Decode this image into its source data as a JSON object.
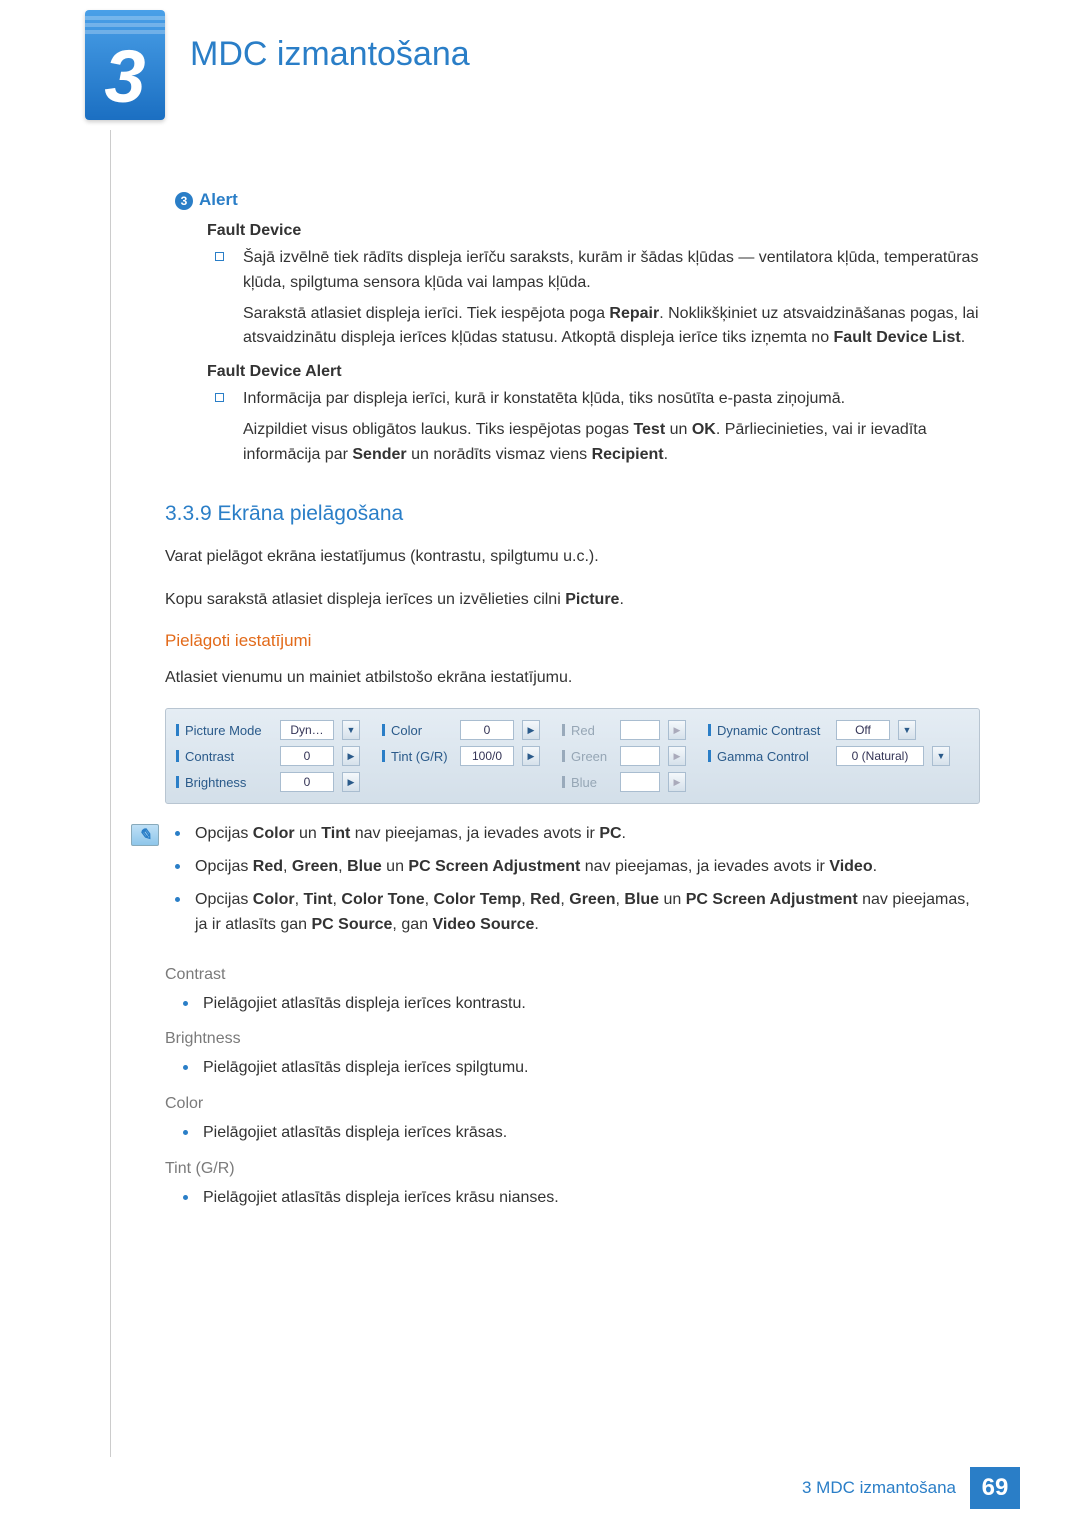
{
  "chapter": {
    "number": "3",
    "title": "MDC izmantošana"
  },
  "alert": {
    "badge": "3",
    "title": "Alert",
    "fault_device_h": "Fault Device",
    "fault_device_p1": "Šajā izvēlnē tiek rādīts displeja ierīču saraksts, kurām ir šādas kļūdas — ventilatora kļūda, temperatūras kļūda, spilgtuma sensora kļūda vai lampas kļūda.",
    "fault_device_p2a": "Sarakstā atlasiet displeja ierīci. Tiek iespējota poga ",
    "fault_device_p2_bold1": "Repair",
    "fault_device_p2b": ". Noklikšķiniet uz atsvaidzināšanas pogas, lai atsvaidzinātu displeja ierīces kļūdas statusu. Atkoptā displeja ierīce tiks izņemta no ",
    "fault_device_p2_bold2": "Fault Device List",
    "fault_device_p2c": ".",
    "fault_alert_h": "Fault Device Alert",
    "fault_alert_p1": "Informācija par displeja ierīci, kurā ir konstatēta kļūda, tiks nosūtīta e-pasta ziņojumā.",
    "fault_alert_p2a": "Aizpildiet visus obligātos laukus. Tiks iespējotas pogas ",
    "fault_alert_p2_b1": "Test",
    "fault_alert_p2_mid": " un ",
    "fault_alert_p2_b2": "OK",
    "fault_alert_p2b": ". Pārliecinieties, vai ir ievadīta informācija par ",
    "fault_alert_p2_b3": "Sender",
    "fault_alert_p2c": " un norādīts vismaz viens ",
    "fault_alert_p2_b4": "Recipient",
    "fault_alert_p2d": "."
  },
  "section": {
    "num_title": "3.3.9  Ekrāna pielāgošana",
    "intro1": "Varat pielāgot ekrāna iestatījumus (kontrastu, spilgtumu u.c.).",
    "intro2a": "Kopu sarakstā atlasiet displeja ierīces un izvēlieties cilni ",
    "intro2_b": "Picture",
    "intro2b": ".",
    "custom_h": "Pielāgoti iestatījumi",
    "custom_p": "Atlasiet vienumu un mainiet atbilstošo ekrāna iestatījumu."
  },
  "panel": {
    "picture_mode_l": "Picture Mode",
    "picture_mode_v": "Dyn…",
    "contrast_l": "Contrast",
    "contrast_v": "0",
    "brightness_l": "Brightness",
    "brightness_v": "0",
    "color_l": "Color",
    "color_v": "0",
    "tint_l": "Tint (G/R)",
    "tint_v": "100/0",
    "red_l": "Red",
    "green_l": "Green",
    "blue_l": "Blue",
    "dyn_l": "Dynamic Contrast",
    "dyn_v": "Off",
    "gamma_l": "Gamma Control",
    "gamma_v": "0 (Natural)"
  },
  "notes": {
    "n1a": "Opcijas ",
    "n1b1": "Color",
    "n1mid1": " un ",
    "n1b2": "Tint",
    "n1c": " nav pieejamas, ja ievades avots ir ",
    "n1b3": "PC",
    "n1d": ".",
    "n2a": "Opcijas ",
    "n2b1": "Red",
    "n2c1": ", ",
    "n2b2": "Green",
    "n2c2": ", ",
    "n2b3": "Blue",
    "n2mid": " un ",
    "n2b4": "PC Screen Adjustment",
    "n2c": " nav pieejamas, ja ievades avots ir ",
    "n2b5": "Video",
    "n2d": ".",
    "n3a": "Opcijas ",
    "n3b1": "Color",
    "n3c1": ", ",
    "n3b2": "Tint",
    "n3c2": ", ",
    "n3b3": "Color Tone",
    "n3c3": ", ",
    "n3b4": "Color Temp",
    "n3c4": ", ",
    "n3b5": "Red",
    "n3c5": ", ",
    "n3b6": "Green",
    "n3c6": ", ",
    "n3b7": "Blue",
    "n3mid": " un ",
    "n3b8": "PC Screen Adjustment",
    "n3c": " nav pieejamas, ja ir atlasīts gan ",
    "n3b9": "PC Source",
    "n3c7": ", gan ",
    "n3b10": "Video Source",
    "n3d": "."
  },
  "props": {
    "contrast_h": "Contrast",
    "contrast_p": "Pielāgojiet atlasītās displeja ierīces kontrastu.",
    "brightness_h": "Brightness",
    "brightness_p": "Pielāgojiet atlasītās displeja ierīces spilgtumu.",
    "color_h": "Color",
    "color_p": "Pielāgojiet atlasītās displeja ierīces krāsas.",
    "tint_h": "Tint (G/R)",
    "tint_p": "Pielāgojiet atlasītās displeja ierīces krāsu nianses."
  },
  "footer": {
    "text": "3 MDC izmantošana",
    "page": "69"
  }
}
